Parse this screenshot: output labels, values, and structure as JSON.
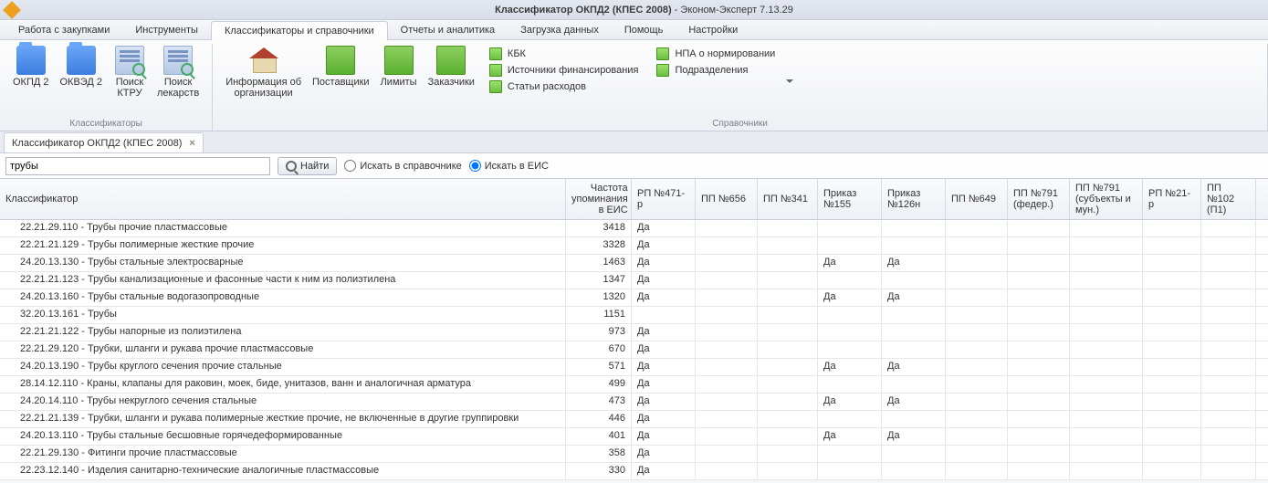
{
  "titlebar": {
    "doc": "Классификатор ОКПД2 (КПЕС 2008)",
    "app": "Эконом-Эксперт 7.13.29"
  },
  "menu": {
    "items": [
      "Работа с закупками",
      "Инструменты",
      "Классификаторы и справочники",
      "Отчеты и аналитика",
      "Загрузка данных",
      "Помощь",
      "Настройки"
    ],
    "active": 2
  },
  "ribbon": {
    "group1": {
      "label": "Классификаторы",
      "btns": [
        {
          "label": "ОКПД 2",
          "icon": "folder"
        },
        {
          "label": "ОКВЭД 2",
          "icon": "folder"
        },
        {
          "label": "Поиск\nКТРУ",
          "icon": "book-mag"
        },
        {
          "label": "Поиск\nлекарств",
          "icon": "book-mag"
        }
      ]
    },
    "group2": {
      "label": "Справочники",
      "bigbtns": [
        {
          "label": "Информация об\nорганизации",
          "icon": "house"
        },
        {
          "label": "Поставщики",
          "icon": "gbook"
        },
        {
          "label": "Лимиты",
          "icon": "gbook"
        },
        {
          "label": "Заказчики",
          "icon": "gbook"
        }
      ],
      "col1": [
        "КБК",
        "Источники финансирования",
        "Статьи расходов"
      ],
      "col2": [
        "НПА о нормировании",
        "Подразделения"
      ]
    }
  },
  "doctab": {
    "label": "Классификатор ОКПД2 (КПЕС 2008)"
  },
  "search": {
    "value": "трубы",
    "find": "Найти",
    "r1": "Искать в справочнике",
    "r2": "Искать в ЕИС"
  },
  "headers": [
    "Классификатор",
    "Частота упоминания в ЕИС",
    "РП №471-р",
    "ПП №656",
    "ПП №341",
    "Приказ №155",
    "Приказ №126н",
    "ПП №649",
    "ПП №791 (федер.)",
    "ПП №791 (субъекты и мун.)",
    "РП №21-р",
    "ПП №102 (П1)"
  ],
  "rows": [
    {
      "name": "22.21.29.110 - Трубы прочие пластмассовые",
      "freq": "3418",
      "c": [
        "Да",
        "",
        "",
        "",
        "",
        "",
        "",
        "",
        "",
        ""
      ]
    },
    {
      "name": "22.21.21.129 - Трубы полимерные жесткие прочие",
      "freq": "3328",
      "c": [
        "Да",
        "",
        "",
        "",
        "",
        "",
        "",
        "",
        "",
        ""
      ]
    },
    {
      "name": "24.20.13.130 - Трубы стальные электросварные",
      "freq": "1463",
      "c": [
        "Да",
        "",
        "",
        "Да",
        "Да",
        "",
        "",
        "",
        "",
        ""
      ]
    },
    {
      "name": "22.21.21.123 - Трубы канализационные и фасонные части к ним из полиэтилена",
      "freq": "1347",
      "c": [
        "Да",
        "",
        "",
        "",
        "",
        "",
        "",
        "",
        "",
        ""
      ]
    },
    {
      "name": "24.20.13.160 - Трубы стальные водогазопроводные",
      "freq": "1320",
      "c": [
        "Да",
        "",
        "",
        "Да",
        "Да",
        "",
        "",
        "",
        "",
        ""
      ]
    },
    {
      "name": "32.20.13.161 - Трубы",
      "freq": "1151",
      "c": [
        "",
        "",
        "",
        "",
        "",
        "",
        "",
        "",
        "",
        ""
      ]
    },
    {
      "name": "22.21.21.122 - Трубы напорные из полиэтилена",
      "freq": "973",
      "c": [
        "Да",
        "",
        "",
        "",
        "",
        "",
        "",
        "",
        "",
        ""
      ]
    },
    {
      "name": "22.21.29.120 - Трубки, шланги и рукава прочие пластмассовые",
      "freq": "670",
      "c": [
        "Да",
        "",
        "",
        "",
        "",
        "",
        "",
        "",
        "",
        ""
      ]
    },
    {
      "name": "24.20.13.190 - Трубы круглого сечения прочие стальные",
      "freq": "571",
      "c": [
        "Да",
        "",
        "",
        "Да",
        "Да",
        "",
        "",
        "",
        "",
        ""
      ]
    },
    {
      "name": "28.14.12.110 - Краны, клапаны для раковин, моек, биде, унитазов, ванн и аналогичная арматура",
      "freq": "499",
      "c": [
        "Да",
        "",
        "",
        "",
        "",
        "",
        "",
        "",
        "",
        ""
      ]
    },
    {
      "name": "24.20.14.110 - Трубы некруглого сечения стальные",
      "freq": "473",
      "c": [
        "Да",
        "",
        "",
        "Да",
        "Да",
        "",
        "",
        "",
        "",
        ""
      ]
    },
    {
      "name": "22.21.21.139 - Трубки, шланги и рукава полимерные жесткие прочие, не включенные в другие группировки",
      "freq": "446",
      "c": [
        "Да",
        "",
        "",
        "",
        "",
        "",
        "",
        "",
        "",
        ""
      ]
    },
    {
      "name": "24.20.13.110 - Трубы стальные бесшовные горячедеформированные",
      "freq": "401",
      "c": [
        "Да",
        "",
        "",
        "Да",
        "Да",
        "",
        "",
        "",
        "",
        ""
      ]
    },
    {
      "name": "22.21.29.130 - Фитинги прочие пластмассовые",
      "freq": "358",
      "c": [
        "Да",
        "",
        "",
        "",
        "",
        "",
        "",
        "",
        "",
        ""
      ]
    },
    {
      "name": "22.23.12.140 - Изделия санитарно-технические аналогичные пластмассовые",
      "freq": "330",
      "c": [
        "Да",
        "",
        "",
        "",
        "",
        "",
        "",
        "",
        "",
        ""
      ]
    }
  ]
}
